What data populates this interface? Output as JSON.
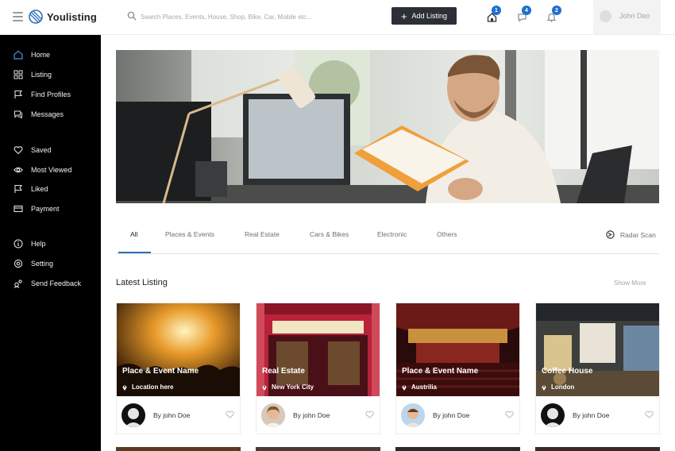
{
  "header": {
    "logo_text": "Youlisting",
    "search_placeholder": "Search Places, Events, House, Shop, Bike, Car, Mobile etc...",
    "add_listing_label": "Add Listing",
    "home_badge": "1",
    "messages_badge": "4",
    "notifications_badge": "2",
    "user_name": "John Deo"
  },
  "sidebar": {
    "groups": [
      [
        {
          "label": "Home",
          "icon": "home-icon"
        },
        {
          "label": "Listing",
          "icon": "grid-icon"
        },
        {
          "label": "Find Profiles",
          "icon": "flag-icon"
        },
        {
          "label": "Messages",
          "icon": "chat-icon"
        }
      ],
      [
        {
          "label": "Saved",
          "icon": "heart-icon"
        },
        {
          "label": "Most Viewed",
          "icon": "eye-icon"
        },
        {
          "label": "Liked",
          "icon": "flag-icon"
        },
        {
          "label": "Payment",
          "icon": "card-icon"
        }
      ],
      [
        {
          "label": "Help",
          "icon": "info-icon"
        },
        {
          "label": "Setting",
          "icon": "settings-icon"
        },
        {
          "label": "Send Feedback",
          "icon": "feedback-icon"
        }
      ]
    ]
  },
  "tabs": {
    "items": [
      "All",
      "Places & Events",
      "Real Estate",
      "Cars & Bikes",
      "Electronic",
      "Others"
    ],
    "active": "All",
    "radar_label": "Radar Scan"
  },
  "latest": {
    "title": "Latest Listing",
    "show_more": "Show More",
    "cards": [
      {
        "title": "Place & Event Name",
        "location": "Location here",
        "author": "By john Doe",
        "image": "concert-image"
      },
      {
        "title": "Real Estate",
        "location": "New York City",
        "author": "By john Doe",
        "image": "storefront-image"
      },
      {
        "title": "Place & Event Name",
        "location": "Austrilia",
        "author": "By john Doe",
        "image": "theater-image"
      },
      {
        "title": "Coffee House",
        "location": "London",
        "author": "By john Doe",
        "image": "cafe-image"
      }
    ]
  },
  "colors": {
    "sidebar_bg": "#000000",
    "accent": "#2d6fba",
    "badge": "#1e6fd0",
    "button_dark": "#2c3036"
  }
}
